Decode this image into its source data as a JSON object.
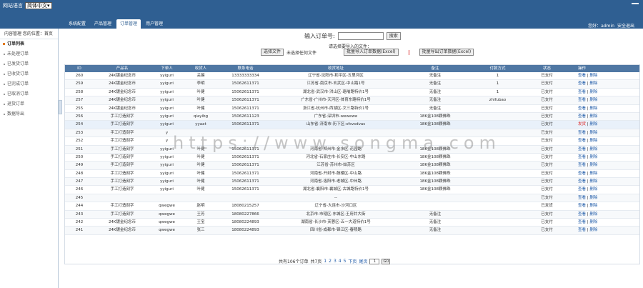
{
  "topbar": {
    "lang_label": "网站语言",
    "lang_value": "简体中文",
    "tabs": [
      "系统配置",
      "产品管理",
      "订单管理",
      "用户管理"
    ],
    "active_tab": 2,
    "user_label": "您好：admin",
    "logout": "安全退出"
  },
  "sidebar": {
    "header": "内容管理  您的位置：首页",
    "items": [
      "订单列表",
      "未处理订单",
      "已发货订单",
      "已收货订单",
      "已完成订单",
      "已取消订单",
      "退货订单",
      "数据导出"
    ]
  },
  "search": {
    "label": "输入订单号:",
    "button": "搜索",
    "import_label": "请选择要导入的文件：",
    "choose_btn": "选择文件",
    "no_file": "未选择任何文件",
    "import_btn": "批量导入订单数据(Excel)",
    "export_btn": "批量导出订单数据(Excel)"
  },
  "table": {
    "headers": [
      "ID",
      "产品名",
      "下单人",
      "收货人",
      "联系电话",
      "收货地址",
      "备注",
      "付款方式",
      "状态",
      "操作"
    ],
    "rows": [
      {
        "id": "260",
        "product": "24K镀金纪念币",
        "buyer": "yyiguri",
        "receiver": "关键",
        "phone": "13333333334",
        "address": "辽宁省-沈阳市-和平区-五里河区",
        "note": "无备注",
        "pay": "1",
        "status": "已支付",
        "hl": false
      },
      {
        "id": "259",
        "product": "24K镀金纪念币",
        "buyer": "yyiguri",
        "receiver": "李明",
        "phone": "15062611371",
        "address": "江苏省-南京市-玄武区-中山路1号",
        "note": "无备注",
        "pay": "1",
        "status": "已支付",
        "hl": false
      },
      {
        "id": "258",
        "product": "24K镀金纪念币",
        "buyer": "yyiguri",
        "receiver": "叶健",
        "phone": "15062611371",
        "address": "湖北省-武汉市-洪山区-珞喻路特价1号",
        "note": "无备注",
        "pay": "1",
        "status": "已支付",
        "hl": false
      },
      {
        "id": "257",
        "product": "24K镀金纪念币",
        "buyer": "yyiguri",
        "receiver": "叶健",
        "phone": "15062611371",
        "address": "广东省-广州市-天河区-体育东路特价1号",
        "note": "无备注",
        "pay": "zhifubao",
        "status": "已支付",
        "hl": false
      },
      {
        "id": "255",
        "product": "24K镀金纪念币",
        "buyer": "yyiguri",
        "receiver": "叶健",
        "phone": "15062611371",
        "address": "浙江省-杭州市-西湖区-文三路特价1号",
        "note": "无备注",
        "pay": "",
        "status": "已支付",
        "hl": false
      },
      {
        "id": "256",
        "product": "手工打造刻字",
        "buyer": "yyiguri",
        "receiver": "qiayibg",
        "phone": "15062611123",
        "address": "广东省-深圳市-wewewe",
        "note": "18K金108颗佛珠",
        "pay": "",
        "status": "已支付",
        "hl": false
      },
      {
        "id": "254",
        "product": "手工打造刻字",
        "buyer": "yyiguri",
        "receiver": "yyaat",
        "phone": "15062611371",
        "address": "山东省-济南市-历下区-sfsvsdvas",
        "note": "18K金108颗佛珠",
        "pay": "",
        "status": "已支付",
        "hl": true
      },
      {
        "id": "253",
        "product": "手工打造刻字",
        "buyer": "y",
        "receiver": "",
        "phone": "",
        "address": "",
        "note": "",
        "pay": "",
        "status": "已支付",
        "hl": false
      },
      {
        "id": "252",
        "product": "手工打造刻字",
        "buyer": "y",
        "receiver": "",
        "phone": "",
        "address": "",
        "note": "",
        "pay": "",
        "status": "已支付",
        "hl": false
      },
      {
        "id": "251",
        "product": "手工打造刻字",
        "buyer": "yyiguri",
        "receiver": "叶健",
        "phone": "15062611371",
        "address": "河南省-郑州市-金水区-花园路",
        "note": "18K金108颗佛珠",
        "pay": "",
        "status": "已支付",
        "hl": false
      },
      {
        "id": "250",
        "product": "手工打造刻字",
        "buyer": "yyiguri",
        "receiver": "叶健",
        "phone": "15062611371",
        "address": "河北省-石家庄市-长安区-中山东路",
        "note": "18K金108颗佛珠",
        "pay": "",
        "status": "已支付",
        "hl": false
      },
      {
        "id": "249",
        "product": "手工打造刻字",
        "buyer": "yyiguri",
        "receiver": "叶健",
        "phone": "15062611371",
        "address": "江苏省-苏州市-姑苏区",
        "note": "18K金108颗佛珠",
        "pay": "",
        "status": "已支付",
        "hl": false
      },
      {
        "id": "248",
        "product": "手工打造刻字",
        "buyer": "yyiguri",
        "receiver": "叶健",
        "phone": "15062611371",
        "address": "河南省-开封市-鼓楼区-中山路",
        "note": "18K金108颗佛珠",
        "pay": "",
        "status": "已支付",
        "hl": false
      },
      {
        "id": "247",
        "product": "手工打造刻字",
        "buyer": "yyiguri",
        "receiver": "叶健",
        "phone": "15062611371",
        "address": "河南省-洛阳市-老城区-中州路",
        "note": "18K金108颗佛珠",
        "pay": "",
        "status": "已支付",
        "hl": false
      },
      {
        "id": "246",
        "product": "手工打造刻字",
        "buyer": "yyiguri",
        "receiver": "叶健",
        "phone": "15062611371",
        "address": "湖北省-襄阳市-襄城区-古城路特价1号",
        "note": "18K金108颗佛珠",
        "pay": "",
        "status": "已支付",
        "hl": false
      },
      {
        "id": "245",
        "product": "",
        "buyer": "",
        "receiver": "",
        "phone": "",
        "address": "--",
        "note": "",
        "pay": "",
        "status": "已支付",
        "hl": false
      },
      {
        "id": "244",
        "product": "手工打造刻字",
        "buyer": "qwegwe",
        "receiver": "赵明",
        "phone": "18080215257",
        "address": "辽宁省-大连市-沙河口区",
        "note": "",
        "pay": "",
        "status": "已发货",
        "hl": false
      },
      {
        "id": "243",
        "product": "手工打造刻字",
        "buyer": "qwegwe",
        "receiver": "王芳",
        "phone": "18080227866",
        "address": "北京市-市辖区-东城区-王府井大街",
        "note": "无备注",
        "pay": "",
        "status": "已支付",
        "hl": false
      },
      {
        "id": "242",
        "product": "24K镀金纪念币",
        "buyer": "qwegwe",
        "receiver": "王宝",
        "phone": "18080224893",
        "address": "湖南省-长沙市-芙蓉区-五一大道特价1号",
        "note": "无备注",
        "pay": "",
        "status": "已支付",
        "hl": false
      },
      {
        "id": "241",
        "product": "24K镀金纪念币",
        "buyer": "qwegwe",
        "receiver": "张三",
        "phone": "18080224893",
        "address": "四川省-成都市-锦江区-春熙路",
        "note": "无备注",
        "pay": "",
        "status": "已支付",
        "hl": false
      }
    ],
    "op_edit": "查看",
    "op_ship": "发货",
    "op_delete": "删除"
  },
  "pager": {
    "summary": "共有106个订单",
    "total_pages": "共7页",
    "pages": [
      "1",
      "2",
      "3",
      "4",
      "5"
    ],
    "next": "下页",
    "last": "尾页",
    "input_value": "1",
    "go": "GO"
  },
  "watermark": "https://www.songma.com",
  "colors": {
    "topbar": "#2f5f92",
    "header_row": "#4f77a3",
    "link": "#1e5aa8",
    "danger": "#d22"
  }
}
